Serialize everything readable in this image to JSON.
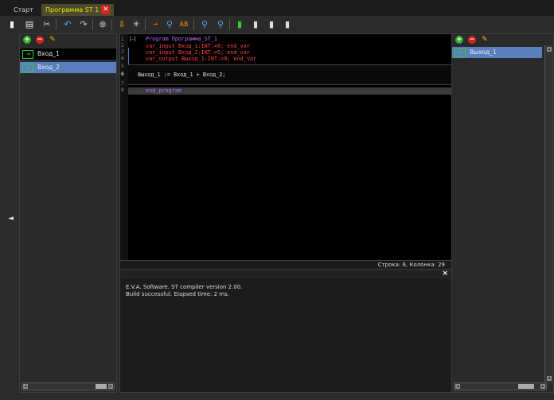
{
  "tabs": [
    {
      "label": "Старт"
    },
    {
      "label": "Программа ST 1",
      "close": "✕"
    }
  ],
  "toolbar": {
    "icons": [
      "new-file-icon",
      "open-file-icon",
      "cut-icon",
      "undo-icon",
      "redo-icon",
      "stop-icon",
      "download-icon",
      "debug-bug-icon",
      "go-to-icon",
      "find-icon",
      "find-replace-icon",
      "zoom-in-icon",
      "zoom-out-icon",
      "bookmark-green-icon",
      "bookmark-prev-icon",
      "bookmark-next-icon",
      "bookmark-clear-icon"
    ]
  },
  "left_panel": {
    "items": [
      {
        "label": "Вход_1",
        "selected": false
      },
      {
        "label": "Вход_2",
        "selected": true
      }
    ]
  },
  "right_panel": {
    "items": [
      {
        "label": "Выход_1",
        "selected": true
      }
    ]
  },
  "editor": {
    "lines": [
      {
        "n": "1",
        "text": "Program Программа_ST_1"
      },
      {
        "n": "2",
        "text": "var_input Вход_1:INT:=0; end_var"
      },
      {
        "n": "3",
        "text": "var_input Вход_2:INT:=0; end_var"
      },
      {
        "n": "4",
        "text": "var_output Выход_1:INT:=0; end_var"
      },
      {
        "n": "5",
        "text": ""
      },
      {
        "n": "6",
        "text": "Выход_1 := Вход_1 + Вход_2;"
      },
      {
        "n": "7",
        "text": ""
      },
      {
        "n": "8",
        "text": "end_program"
      }
    ],
    "fold_marker": "[-]",
    "status": "Строка: 6, Колонка: 29"
  },
  "output": {
    "close": "×",
    "lines": [
      "E.V.A. Software. ST compiler version 2.00.",
      "Build successful. Elapsed time: 2 ms."
    ]
  },
  "side_toggle": "◄",
  "colors": {
    "accent": "#5a7fbf",
    "keyword": "#b06cff",
    "type": "#ff4040",
    "green": "#2fd02f"
  }
}
